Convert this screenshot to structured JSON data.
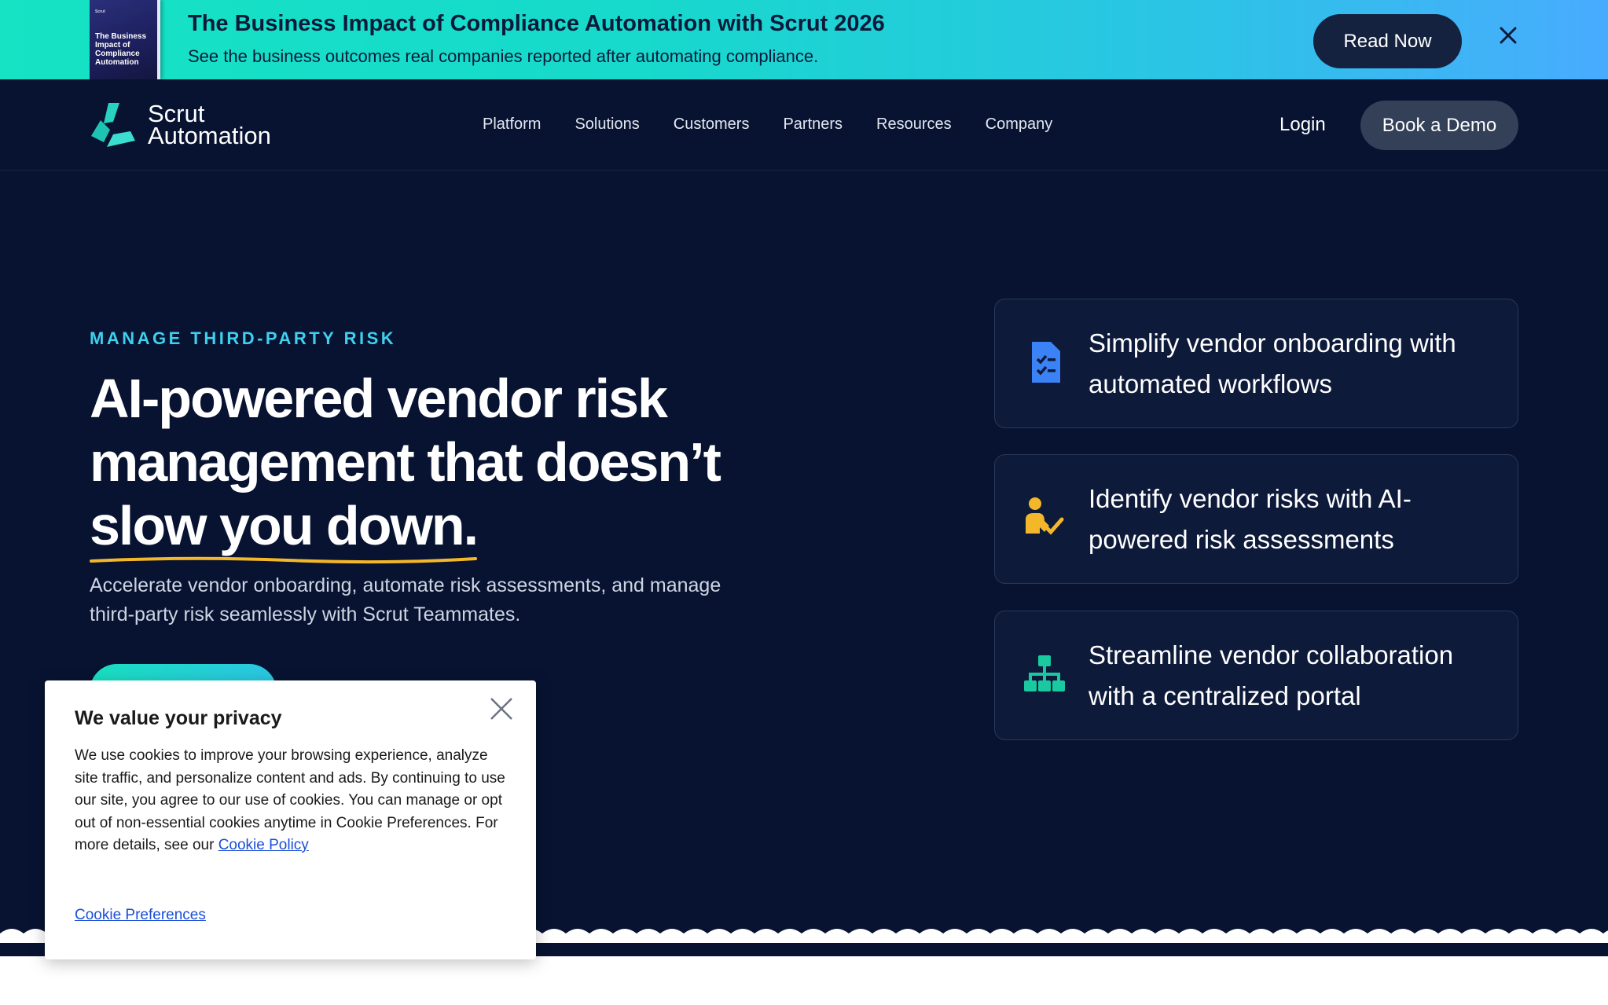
{
  "promo": {
    "book_cover_title": "The Business Impact of Compliance Automation",
    "title": "The Business Impact of Compliance Automation with Scrut 2026",
    "subtitle": "See the business outcomes real companies reported after automating compliance.",
    "read_label": "Read Now"
  },
  "header": {
    "logo_line1": "Scrut",
    "logo_line2": "Automation",
    "nav": [
      "Platform",
      "Solutions",
      "Customers",
      "Partners",
      "Resources",
      "Company"
    ],
    "login_label": "Login",
    "demo_label": "Book a Demo"
  },
  "hero": {
    "eyebrow": "MANAGE THIRD-PARTY RISK",
    "headline_line1": "AI-powered vendor risk",
    "headline_line2": "management that doesn’t",
    "headline_line3": "slow you down.",
    "description": "Accelerate vendor onboarding, automate risk assessments, and manage third-party risk seamlessly with Scrut Teammates."
  },
  "features": [
    {
      "icon": "document-checklist-icon",
      "color": "#3b82f6",
      "text": "Simplify vendor onboarding with automated workflows"
    },
    {
      "icon": "person-check-icon",
      "color": "#f5b72a",
      "text": "Identify vendor risks with AI-powered risk assessments"
    },
    {
      "icon": "org-chart-icon",
      "color": "#19c9a0",
      "text": "Streamline vendor collaboration with a centralized portal"
    }
  ],
  "cookie": {
    "title": "We value your privacy",
    "body": "We use cookies to improve your browsing experience, analyze site traffic, and personalize content and ads. By continuing to use our site, you agree to our use of cookies. You can manage or opt out of non-essential cookies anytime in Cookie Preferences. For more details, see our",
    "policy_link": "Cookie Policy",
    "preferences_link": "Cookie Preferences"
  },
  "colors": {
    "navy_bg": "#071331",
    "accent_teal": "#3fd0ee",
    "underline_yellow": "#f5b72a"
  }
}
